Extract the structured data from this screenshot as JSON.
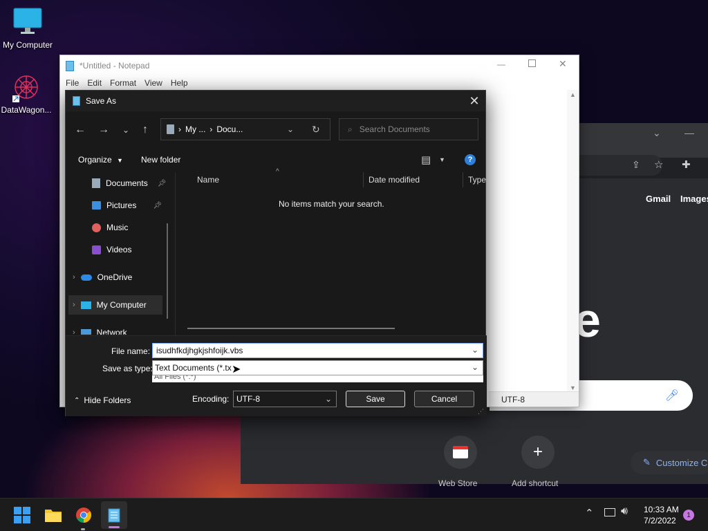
{
  "desktop": {
    "icons": [
      {
        "label": "My Computer"
      },
      {
        "label": "DataWagon..."
      }
    ]
  },
  "chrome": {
    "links": [
      "Gmail",
      "Images"
    ],
    "shortcuts": [
      {
        "label": "Web Store"
      },
      {
        "label": "Add shortcut"
      }
    ],
    "customize_label": "Customize C",
    "logo_fragment": "e"
  },
  "notepad": {
    "title": "*Untitled - Notepad",
    "menu": [
      "File",
      "Edit",
      "Format",
      "View",
      "Help"
    ],
    "status_encoding": "UTF-8"
  },
  "dialog": {
    "title": "Save As",
    "address": {
      "crumb1": "My ...",
      "crumb2": "Docu..."
    },
    "search_placeholder": "Search Documents",
    "organize_label": "Organize",
    "new_folder_label": "New folder",
    "sidebar": [
      {
        "label": "Documents",
        "pinned": true
      },
      {
        "label": "Pictures",
        "pinned": true
      },
      {
        "label": "Music"
      },
      {
        "label": "Videos"
      },
      {
        "label": "OneDrive"
      },
      {
        "label": "My Computer"
      },
      {
        "label": "Network"
      }
    ],
    "columns": [
      "Name",
      "Date modified",
      "Type"
    ],
    "empty_message": "No items match your search.",
    "file_name_label": "File name:",
    "file_name_value": "isudhfkdjhgkjshfoijk.vbs",
    "save_type_label": "Save as type:",
    "save_type_value": "Text Documents (*.tx",
    "save_type_option_peek": "All Files  (*.*)",
    "hide_folders_label": "Hide Folders",
    "encoding_label": "Encoding:",
    "encoding_value": "UTF-8",
    "save_label": "Save",
    "cancel_label": "Cancel"
  },
  "taskbar": {
    "time": "10:33 AM",
    "date": "7/2/2022",
    "notification_count": "1"
  }
}
